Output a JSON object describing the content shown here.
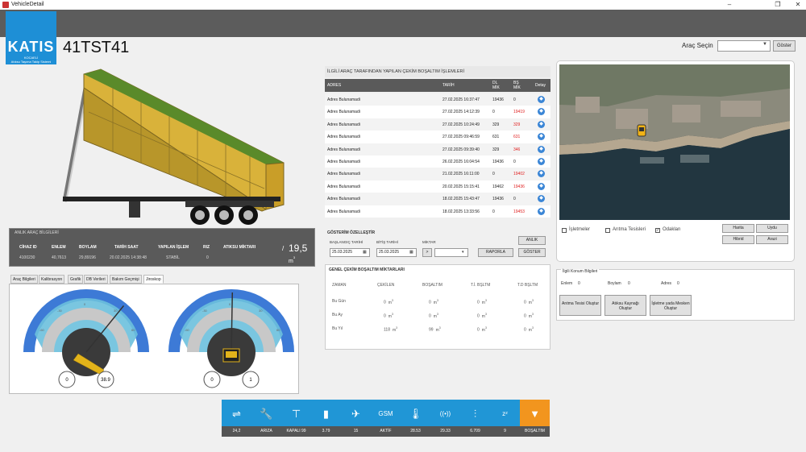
{
  "window": {
    "title": "VehicleDetail",
    "minimize": "–",
    "maximize": "❐",
    "close": "✕"
  },
  "logo": {
    "text": "KATIS",
    "sub1": "KOCAELİ",
    "sub2": "Atıksu Taşıma Takip Sistemi"
  },
  "vehicle": {
    "plate": "41TST41"
  },
  "vehicle_select": {
    "label": "Araç Seçin",
    "value": "",
    "button": "Göster"
  },
  "live_info": {
    "title": "ANLIK ARAÇ BİLGİLERİ",
    "headers": [
      "CİHAZ ID",
      "ENLEM",
      "BOYLAM",
      "TARİH SAAT",
      "YAPILAN İŞLEM",
      "RIZ",
      "ATIKSU MİKTARI"
    ],
    "values": [
      "4100230",
      "40,7613",
      "29,89196",
      "20.02.2025 14:38:48",
      "STABİL",
      "0"
    ],
    "amount_sep": "/",
    "amount": "19,5",
    "unit": "m",
    "unit_exp": "3"
  },
  "tabs": [
    "Araç Bilgileri",
    "Kalibrasyon",
    "Grafik",
    "DB Verileri",
    "Bakım Geçmişi",
    "Jiroskop"
  ],
  "gauges": [
    {
      "needle_deg": 38.9,
      "left_value": "0",
      "right_value": "38.9",
      "min_label": "-90",
      "max_label": "90",
      "tick_labels": [
        "-60",
        "-30",
        "0",
        "30",
        "60"
      ]
    },
    {
      "needle_deg": 1,
      "left_value": "0",
      "right_value": "1",
      "min_label": "-90",
      "max_label": "90",
      "tick_labels": [
        "-60",
        "-30",
        "0",
        "30",
        "60"
      ]
    }
  ],
  "transactions": {
    "title": "İLGİLİ ARAÇ TARAFINDAN YAPILAN ÇEKİM BOŞALTIM İŞLEMLERİ",
    "headers": [
      "ADRES",
      "TARİH",
      "DL MİK",
      "BŞ MİK",
      "Detay"
    ],
    "rows": [
      {
        "address": "Adres Bulunamadi",
        "date": "27.02.2025 16:37:47",
        "dl": "19436",
        "bs": "0",
        "red": false
      },
      {
        "address": "Adres Bulunamadi",
        "date": "27.02.2025 14:12:39",
        "dl": "0",
        "bs": "19419",
        "red": true
      },
      {
        "address": "Adres Bulunamadi",
        "date": "27.02.2025 10:24:49",
        "dl": "329",
        "bs": "329",
        "red": true
      },
      {
        "address": "Adres Bulunamadi",
        "date": "27.02.2025 09:46:59",
        "dl": "631",
        "bs": "631",
        "red": true
      },
      {
        "address": "Adres Bulunamadi",
        "date": "27.02.2025 09:39:40",
        "dl": "329",
        "bs": "346",
        "red": true
      },
      {
        "address": "Adres Bulunamadi",
        "date": "26.02.2025 16:04:54",
        "dl": "19436",
        "bs": "0",
        "red": false
      },
      {
        "address": "Adres Bulunamadi",
        "date": "21.02.2025 16:11:00",
        "dl": "0",
        "bs": "19402",
        "red": true
      },
      {
        "address": "Adres Bulunamadi",
        "date": "20.02.2025 15:15:41",
        "dl": "19462",
        "bs": "19436",
        "red": true
      },
      {
        "address": "Adres Bulunamadi",
        "date": "18.02.2025 15:43:47",
        "dl": "19436",
        "bs": "0",
        "red": false
      },
      {
        "address": "Adres Bulunamadi",
        "date": "18.02.2025 13:33:56",
        "dl": "0",
        "bs": "19453",
        "red": true
      }
    ]
  },
  "display_settings": {
    "title": "GÖSTERİM ÖZELLEŞTİR",
    "start_label": "BAŞLANGIÇ TARİHİ",
    "start_value": "25.03.2025",
    "end_label": "BİTİŞ TARİHİ",
    "end_value": "25.03.2025",
    "amount_label": "MİKTAR",
    "amount_op": ">",
    "anlik_button": "ANLIK",
    "report_button": "RAPORLA",
    "show_button": "GÖSTER"
  },
  "totals": {
    "title": "GENEL ÇEKİM BOŞALTIM MİKTARLARI",
    "headers": [
      "ZAMAN",
      "ÇEKİLEN",
      "BOŞALTIM",
      "T.İ. BŞLTM",
      "T.D BŞLTM"
    ],
    "rows": [
      {
        "label": "Bu Gün",
        "vals": [
          "0",
          "0",
          "0",
          "0"
        ]
      },
      {
        "label": "Bu Ay",
        "vals": [
          "0",
          "0",
          "0",
          "0"
        ]
      },
      {
        "label": "Bu Yıl",
        "vals": [
          "118",
          "99",
          "0",
          "0"
        ]
      }
    ],
    "unit": "m",
    "unit_exp": "3"
  },
  "map_controls": {
    "checkboxes": [
      {
        "label": "İşletmeler",
        "checked": false
      },
      {
        "label": "Arıtma Tesisleri",
        "checked": false
      },
      {
        "label": "Odaklan",
        "checked": true
      }
    ],
    "buttons": [
      "Harita",
      "Uydu",
      "Hibrid",
      "Arazi"
    ]
  },
  "location_info": {
    "title": "İlgili Konum Bilgileri",
    "lat_label": "Enlem",
    "lat_value": "0",
    "lon_label": "Boylam",
    "lon_value": "0",
    "addr_label": "Adres",
    "addr_value": "0",
    "buttons": [
      "Arıtma Tesisi Oluştur",
      "Atıksu Kaynağı Oluştur",
      "İşletme yada Mesken Oluştur"
    ]
  },
  "status_bar": [
    {
      "icon": "battery-plug-icon",
      "glyph": "⇌",
      "value": "24,2"
    },
    {
      "icon": "wrench-icon",
      "glyph": "🔧",
      "value": "ARIZA"
    },
    {
      "icon": "valve-icon",
      "glyph": "⊤",
      "value": "KAPALI 99"
    },
    {
      "icon": "battery-icon",
      "glyph": "▮",
      "value": "3.79"
    },
    {
      "icon": "satellite-icon",
      "glyph": "✈",
      "value": "15"
    },
    {
      "icon": "gsm-icon",
      "glyph": "GSM",
      "value": "AKTİF"
    },
    {
      "icon": "thermometer-icon",
      "glyph": "🌡",
      "value": "28.53"
    },
    {
      "icon": "signal-icon",
      "glyph": "((•))",
      "value": "29.33"
    },
    {
      "icon": "sliders-icon",
      "glyph": "⫶",
      "value": "6.709"
    },
    {
      "icon": "sleep-icon",
      "glyph": "zᶻ",
      "value": "9"
    },
    {
      "icon": "dump-icon",
      "glyph": "▼",
      "value": "BOŞALTIM"
    }
  ]
}
